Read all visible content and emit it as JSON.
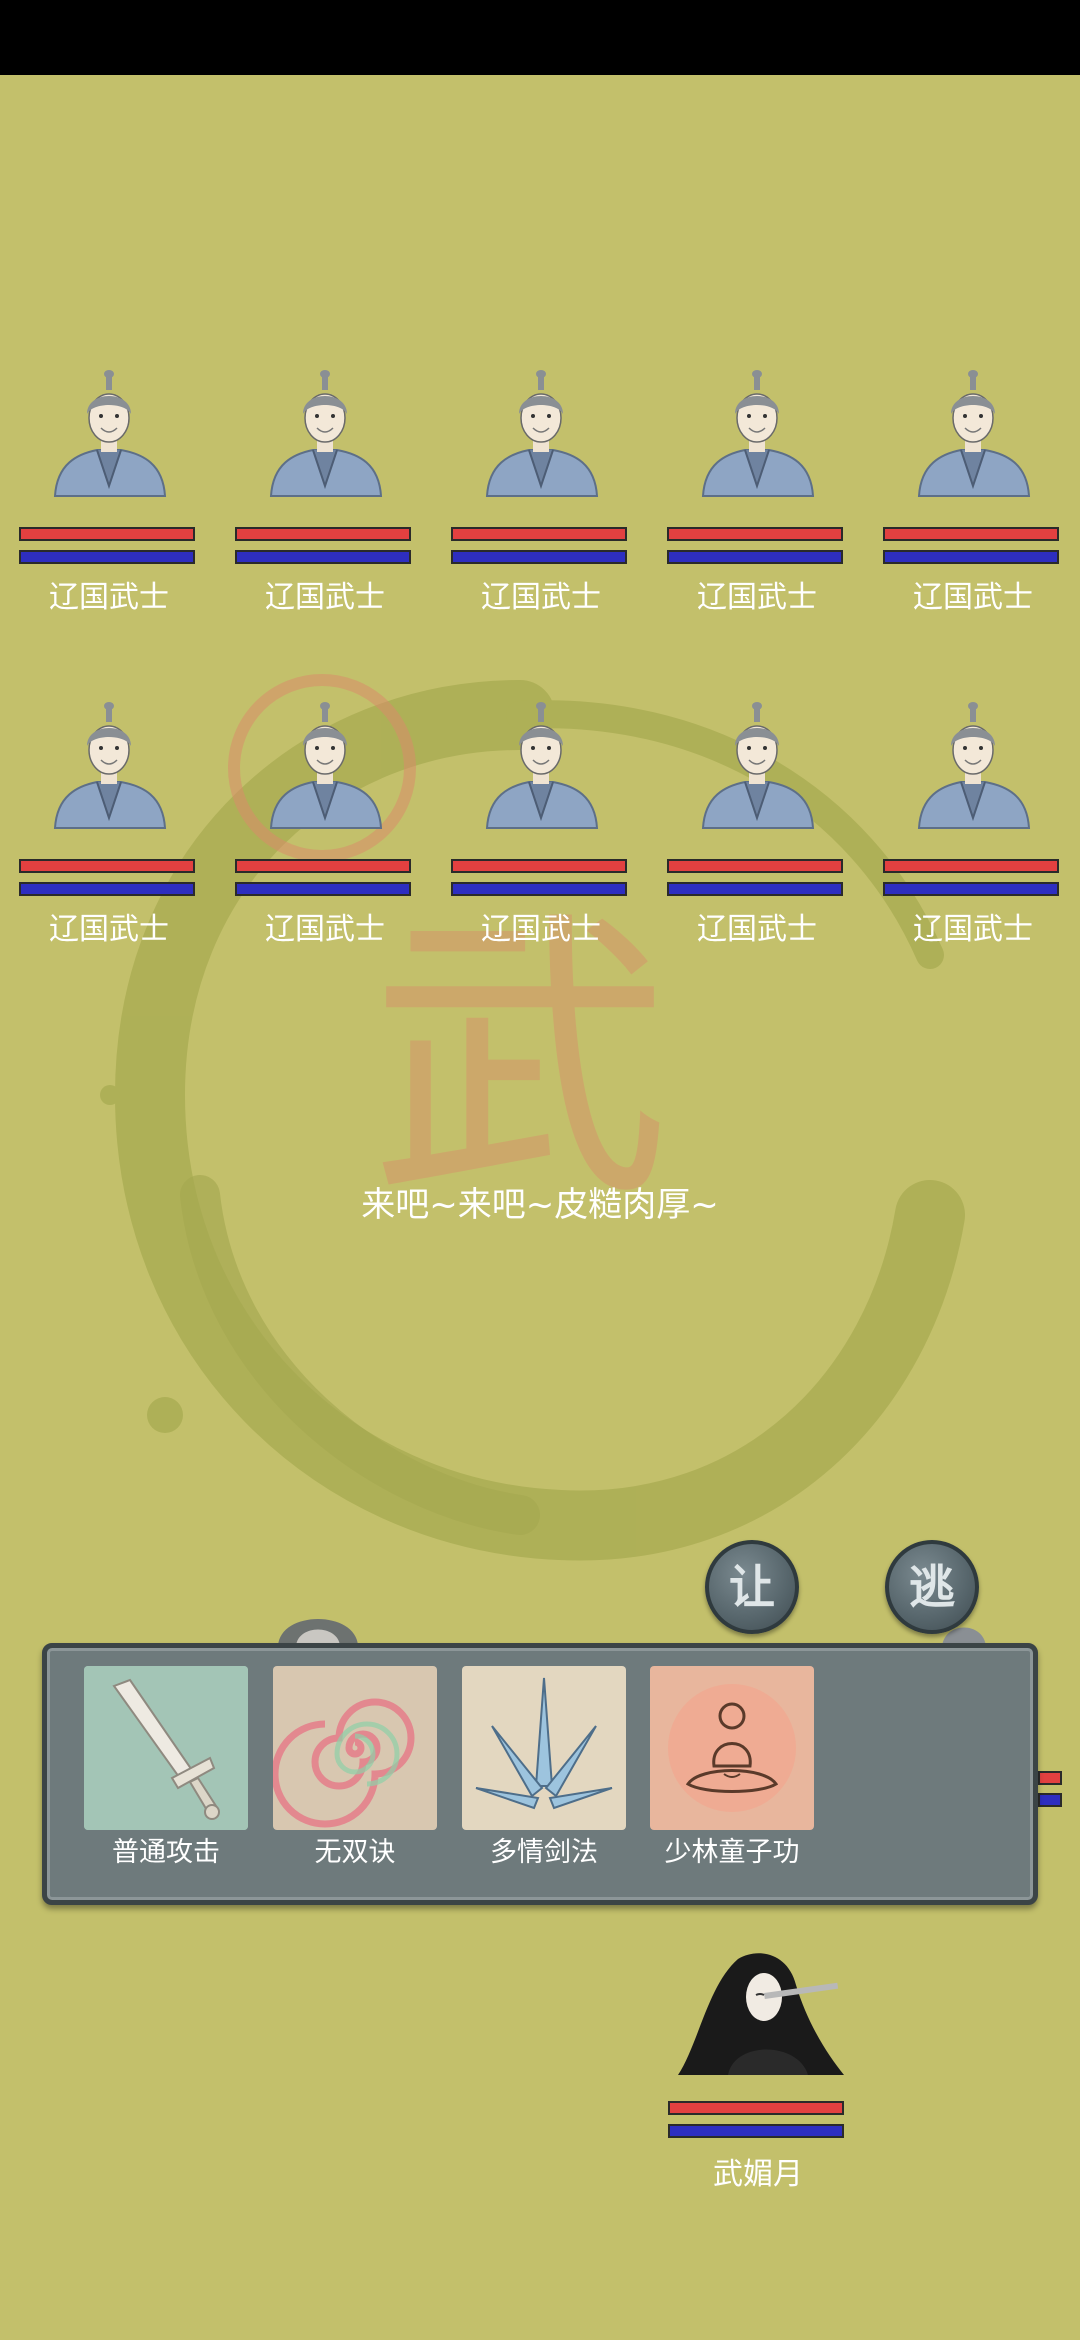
{
  "enemies": [
    {
      "name": "辽国武士"
    },
    {
      "name": "辽国武士"
    },
    {
      "name": "辽国武士"
    },
    {
      "name": "辽国武士"
    },
    {
      "name": "辽国武士"
    },
    {
      "name": "辽国武士"
    },
    {
      "name": "辽国武士"
    },
    {
      "name": "辽国武士"
    },
    {
      "name": "辽国武士"
    },
    {
      "name": "辽国武士"
    }
  ],
  "background_character": "武",
  "dialogue": "来吧~来吧~皮糙肉厚~",
  "buttons": {
    "yield_label": "让",
    "flee_label": "逃"
  },
  "skills": [
    {
      "label": "普通攻击",
      "icon": "sword-icon"
    },
    {
      "label": "无双诀",
      "icon": "spiral-icon"
    },
    {
      "label": "多情剑法",
      "icon": "blades-icon"
    },
    {
      "label": "少林童子功",
      "icon": "meditation-icon"
    }
  ],
  "player": {
    "name": "武媚月"
  },
  "colors": {
    "background": "#c3c06b",
    "hp": "#e24040",
    "mp": "#2e2ec0",
    "panel": "#6e7a7c"
  }
}
